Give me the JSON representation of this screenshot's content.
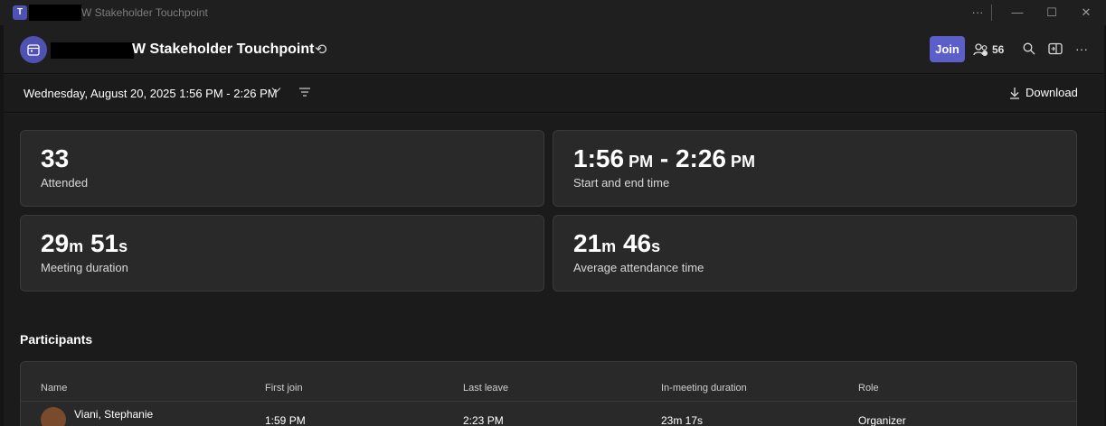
{
  "window": {
    "title": "W Stakeholder Touchpoint",
    "controls": {
      "more": "···",
      "minimize": "—",
      "maximize": "☐",
      "close": "✕"
    }
  },
  "header": {
    "meeting_title": "W Stakeholder Touchpoint",
    "recurring_icon": "recurring-icon",
    "join_label": "Join",
    "participants_count": "56",
    "icons": [
      "search-icon",
      "share-tray-icon",
      "more-options-icon"
    ]
  },
  "toolbar": {
    "date_range": "Wednesday, August 20, 2025 1:56 PM - 2:26 PM",
    "download_label": "Download"
  },
  "stats": {
    "attended": {
      "value": "33",
      "label": "Attended"
    },
    "start_end": {
      "start": "1:56",
      "start_unit": "PM",
      "sep": "-",
      "end": "2:26",
      "end_unit": "PM",
      "label": "Start and end time"
    },
    "meeting_duration": {
      "min": "29",
      "min_unit": "m",
      "sec": "51",
      "sec_unit": "s",
      "label": "Meeting duration"
    },
    "avg_attendance": {
      "min": "21",
      "min_unit": "m",
      "sec": "46",
      "sec_unit": "s",
      "label": "Average attendance time"
    }
  },
  "participants": {
    "title": "Participants",
    "columns": [
      "Name",
      "First join",
      "Last leave",
      "In-meeting duration",
      "Role"
    ],
    "rows": [
      {
        "name": "Viani, Stephanie",
        "first_join": "1:59 PM",
        "last_leave": "2:23 PM",
        "duration": "23m 17s",
        "role": "Organizer"
      }
    ]
  },
  "colors": {
    "accent": "#5b5fc7",
    "background": "#1f1f1f",
    "card": "#292929"
  }
}
